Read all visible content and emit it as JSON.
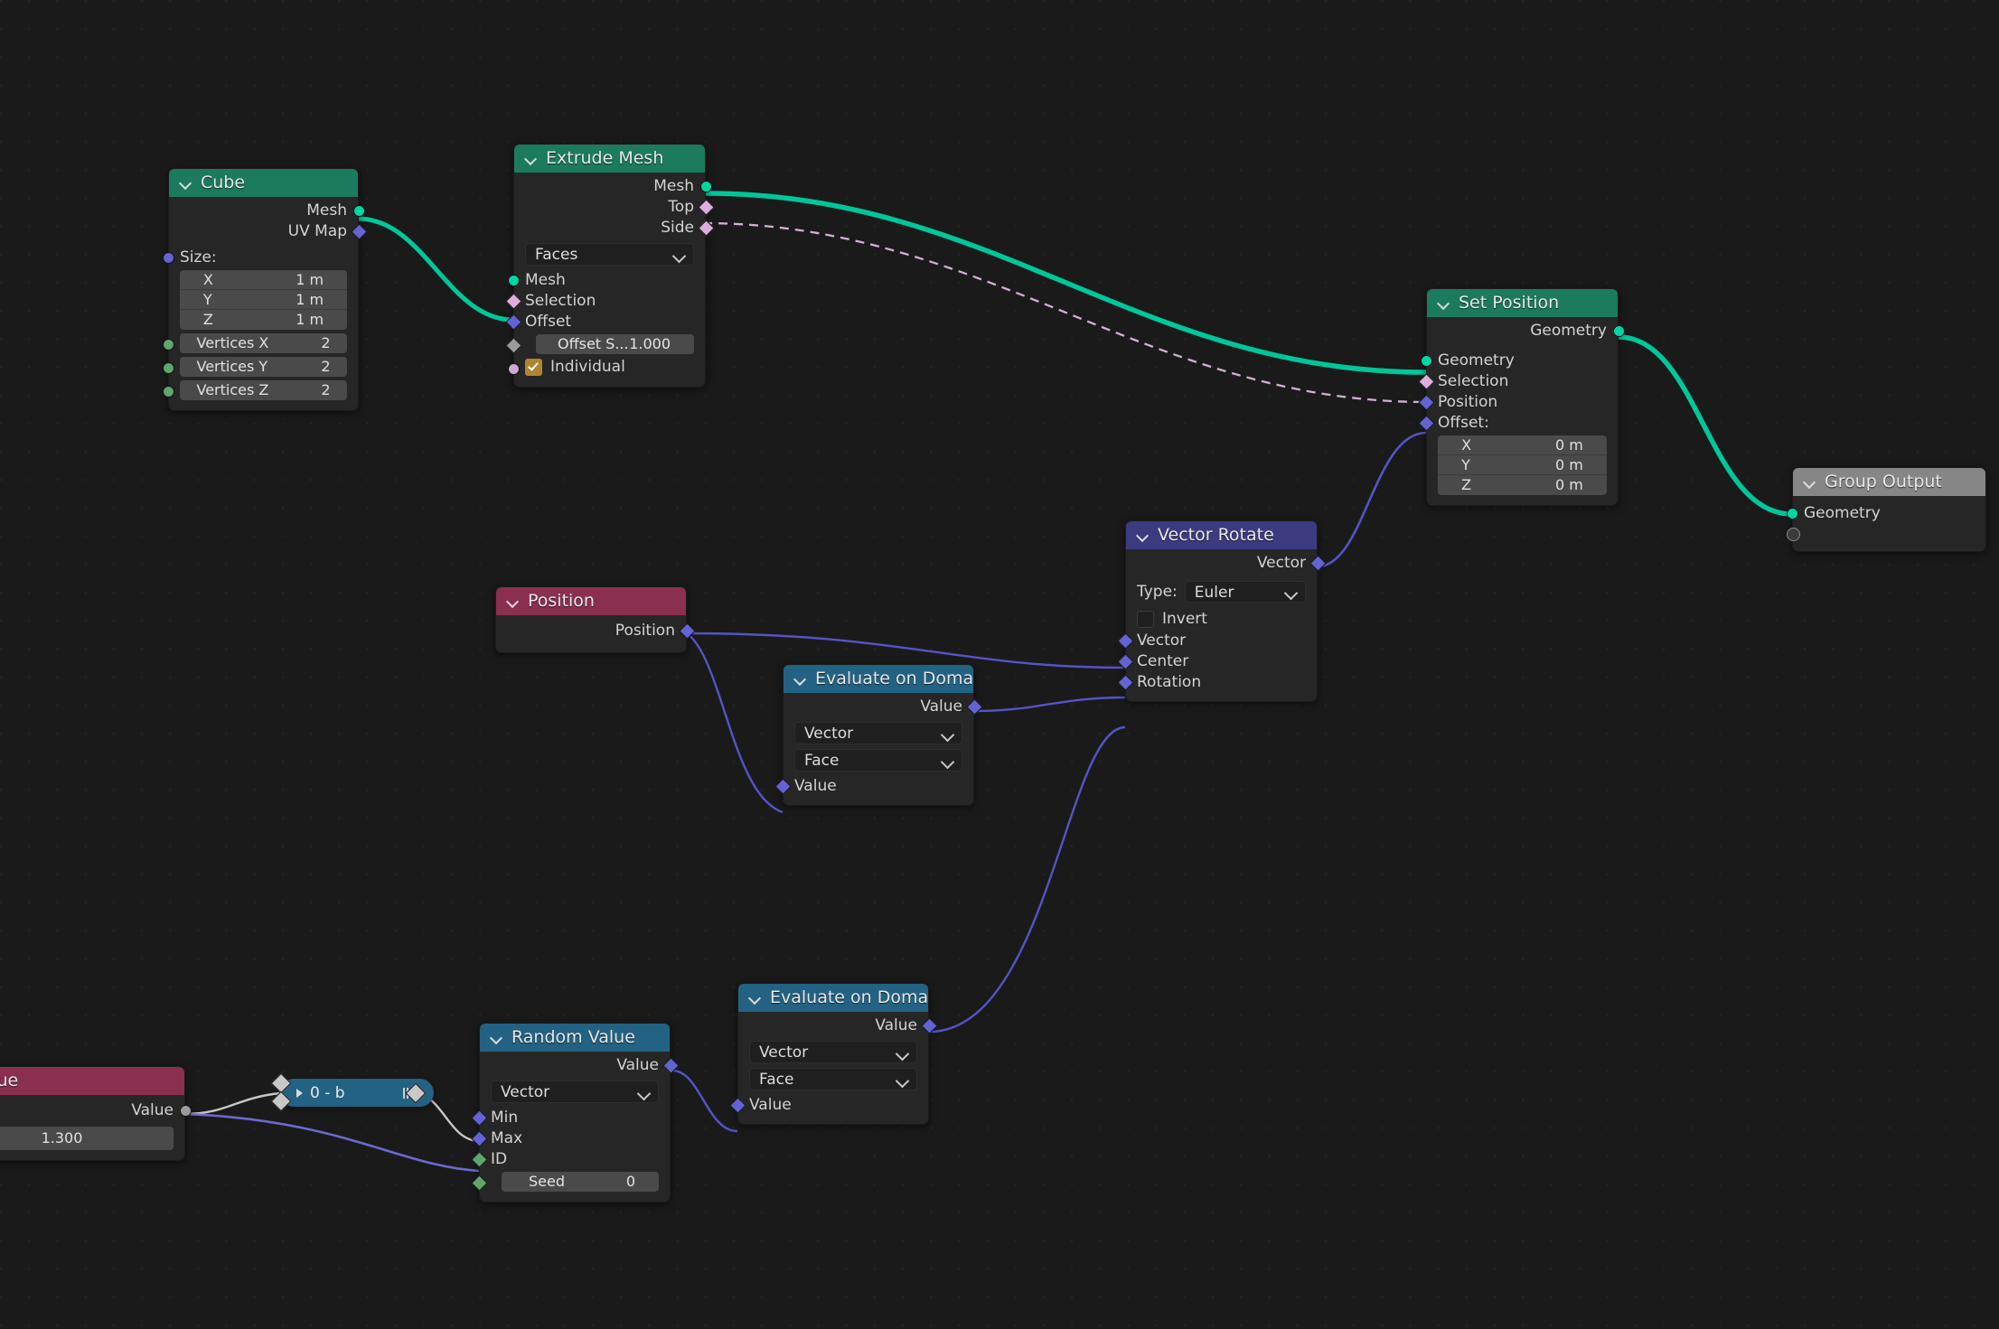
{
  "editor": {
    "name": "Geometry Node Editor",
    "background_color": "#1a1a1a",
    "grid_dot_color": "#252525"
  },
  "colors": {
    "geometry_header": "#1c7a5e",
    "vector_header": "#3c3b80",
    "input_header": "#8a2f50",
    "converter_header": "#246283",
    "output_header": "#868686",
    "geometry_socket": "#00d6a3",
    "vector_socket": "#6363d2",
    "field_socket": "#dcaedd",
    "integer_socket": "#5fa56d",
    "value_socket": "#9b9b9b",
    "boolean_socket": "#cca6d4"
  },
  "nodes": {
    "cube": {
      "title": "Cube",
      "outputs": [
        {
          "label": "Mesh",
          "type": "geometry"
        },
        {
          "label": "UV Map",
          "type": "vector"
        }
      ],
      "inputs": [
        {
          "label": "Size:",
          "type": "vector"
        }
      ],
      "size_fields": [
        {
          "label": "X",
          "value": "1 m"
        },
        {
          "label": "Y",
          "value": "1 m"
        },
        {
          "label": "Z",
          "value": "1 m"
        }
      ],
      "vertex_fields": [
        {
          "label": "Vertices X",
          "value": "2"
        },
        {
          "label": "Vertices Y",
          "value": "2"
        },
        {
          "label": "Vertices Z",
          "value": "2"
        }
      ]
    },
    "extrude_mesh": {
      "title": "Extrude Mesh",
      "outputs": [
        {
          "label": "Mesh",
          "type": "geometry"
        },
        {
          "label": "Top",
          "type": "field"
        },
        {
          "label": "Side",
          "type": "field"
        }
      ],
      "mode_dropdown": "Faces",
      "inputs": [
        {
          "label": "Mesh",
          "type": "geometry"
        },
        {
          "label": "Selection",
          "type": "field"
        },
        {
          "label": "Offset",
          "type": "vector"
        }
      ],
      "offset_scale": {
        "label": "Offset S...",
        "value": "1.000"
      },
      "individual": {
        "label": "Individual",
        "checked": true
      }
    },
    "set_position": {
      "title": "Set Position",
      "outputs": [
        {
          "label": "Geometry",
          "type": "geometry"
        }
      ],
      "inputs": [
        {
          "label": "Geometry",
          "type": "geometry"
        },
        {
          "label": "Selection",
          "type": "field"
        },
        {
          "label": "Position",
          "type": "vector"
        },
        {
          "label": "Offset:",
          "type": "vector"
        }
      ],
      "offset_fields": [
        {
          "label": "X",
          "value": "0 m"
        },
        {
          "label": "Y",
          "value": "0 m"
        },
        {
          "label": "Z",
          "value": "0 m"
        }
      ]
    },
    "group_output": {
      "title": "Group Output",
      "inputs": [
        {
          "label": "Geometry",
          "type": "geometry"
        }
      ]
    },
    "vector_rotate": {
      "title": "Vector Rotate",
      "outputs": [
        {
          "label": "Vector",
          "type": "vector"
        }
      ],
      "type_label": "Type:",
      "type_value": "Euler",
      "invert": {
        "label": "Invert",
        "checked": false
      },
      "inputs": [
        {
          "label": "Vector",
          "type": "vector"
        },
        {
          "label": "Center",
          "type": "vector"
        },
        {
          "label": "Rotation",
          "type": "vector"
        }
      ]
    },
    "position": {
      "title": "Position",
      "outputs": [
        {
          "label": "Position",
          "type": "vector"
        }
      ]
    },
    "evaluate_on_domain_1": {
      "title": "Evaluate on Domain",
      "outputs": [
        {
          "label": "Value",
          "type": "vector"
        }
      ],
      "data_type": "Vector",
      "domain": "Face",
      "inputs": [
        {
          "label": "Value",
          "type": "vector"
        }
      ]
    },
    "evaluate_on_domain_2": {
      "title": "Evaluate on Domain",
      "outputs": [
        {
          "label": "Value",
          "type": "vector"
        }
      ],
      "data_type": "Vector",
      "domain": "Face",
      "inputs": [
        {
          "label": "Value",
          "type": "vector"
        }
      ]
    },
    "random_value": {
      "title": "Random Value",
      "outputs": [
        {
          "label": "Value",
          "type": "vector"
        }
      ],
      "data_type": "Vector",
      "inputs": [
        {
          "label": "Min",
          "type": "vector"
        },
        {
          "label": "Max",
          "type": "vector"
        },
        {
          "label": "ID",
          "type": "integer"
        }
      ],
      "seed": {
        "label": "Seed",
        "value": "0"
      }
    },
    "value": {
      "title": "Value",
      "outputs": [
        {
          "label": "Value",
          "type": "value"
        }
      ],
      "value_field": "1.300"
    },
    "collapsed_math": {
      "title": "0 - b",
      "expand_icon": "chevron-right-icon",
      "pause_icon": "pause-icon"
    }
  }
}
